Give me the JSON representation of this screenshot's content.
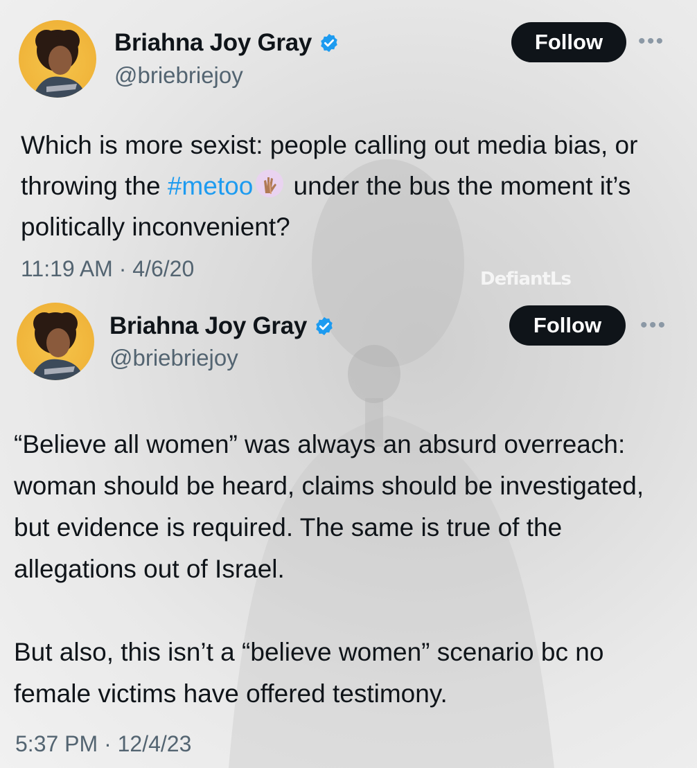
{
  "tweets": [
    {
      "name": "Briahna Joy Gray",
      "handle": "@briebriejoy",
      "follow_label": "Follow",
      "more_icon": "more-horizontal-icon",
      "verified_icon": "verified-badge-icon",
      "text": {
        "part1": "Which is more sexist: people calling out media bias, or throwing the ",
        "hashtag": "#metoo",
        "emoji": "raised-hands-emoji",
        "part2": " under the bus the moment it’s politically inconvenient?"
      },
      "timestamp": "11:19 AM · 4/6/20"
    },
    {
      "name": "Briahna Joy Gray",
      "handle": "@briebriejoy",
      "follow_label": "Follow",
      "more_icon": "more-horizontal-icon",
      "verified_icon": "verified-badge-icon",
      "text": {
        "paragraph1": "“Believe all women” was always an absurd overreach: woman should be heard, claims should be investigated, but evidence is required. The same is true of the allegations out of Israel.",
        "paragraph2": "But also, this isn’t a “believe women” scenario bc no female victims have offered testimony."
      },
      "timestamp": "5:37 PM · 12/4/23"
    }
  ],
  "watermark": "DefiantLs",
  "colors": {
    "accent": "#1d9bf0",
    "text": "#0f1419",
    "secondary": "#536471",
    "button": "#0f1419"
  }
}
